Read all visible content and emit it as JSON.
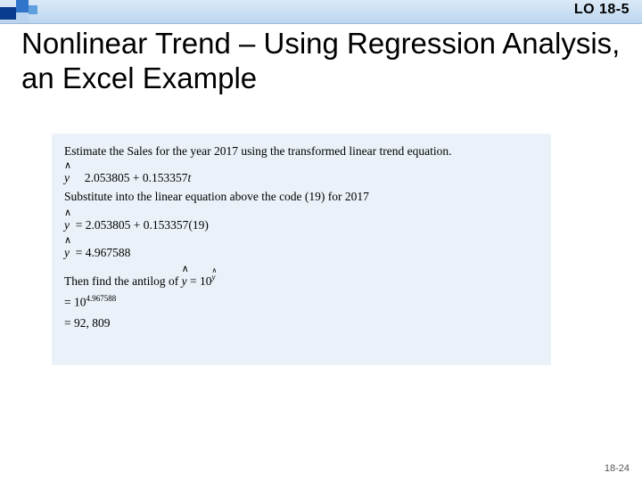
{
  "header": {
    "lo_tag": "LO 18-5"
  },
  "title": "Nonlinear Trend – Using Regression Analysis, an Excel Example",
  "body": {
    "line1": "Estimate the Sales for the year 2017 using the transformed linear trend equation.",
    "eq1_lhs": "y",
    "eq1_rhs": " 2.053805 + 0.153357",
    "eq1_var": "t",
    "line2": "Substitute into the linear equation above the code (19) for 2017",
    "eq2_lhs": "y",
    "eq2_rhs": "= 2.053805 + 0.153357(19)",
    "eq3_lhs": "y",
    "eq3_rhs": "= 4.967588",
    "line3_a": "Then find the antilog of ",
    "line3_yhat": "y",
    "line3_b": " = 10",
    "line3_sup_y": "y",
    "eq4": "= 10",
    "eq4_sup": "4.967588",
    "eq5": "= 92, 809"
  },
  "footer": {
    "page": "18-24"
  }
}
